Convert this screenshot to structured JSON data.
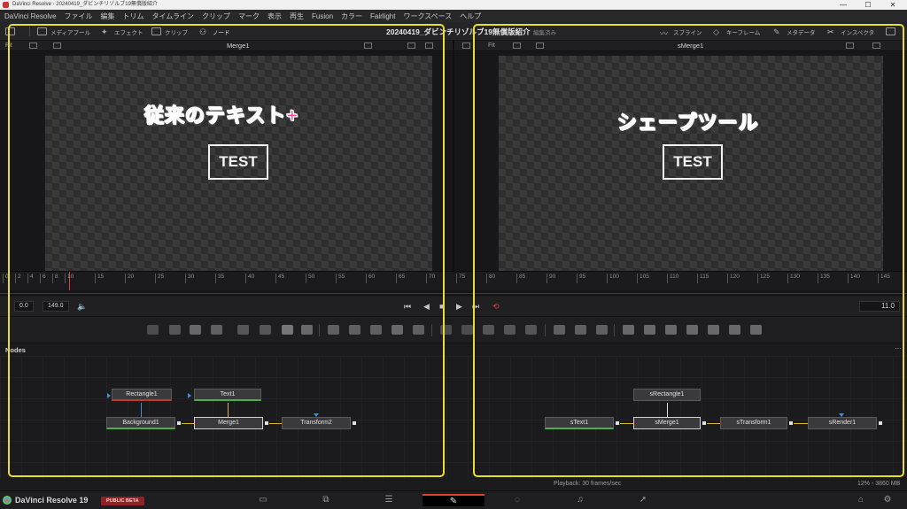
{
  "window": {
    "title": "DaVinci Resolve - 20240419_ダビンチリゾルブ19無償版紹介",
    "minimize": "—",
    "maximize": "☐",
    "close": "✕"
  },
  "menu": [
    "DaVinci Resolve",
    "ファイル",
    "編集",
    "トリム",
    "タイムライン",
    "クリップ",
    "マーク",
    "表示",
    "再生",
    "Fusion",
    "カラー",
    "Fairlight",
    "ワークスペース",
    "ヘルプ"
  ],
  "toolbar": {
    "media_pool": "メディアプール",
    "effects": "エフェクト",
    "clips": "クリップ",
    "nodes": "ノード",
    "project_title": "20240419_ダビンチリゾルブ19無償版紹介",
    "status": "編集済み",
    "spline": "スプライン",
    "keyframes": "キーフレーム",
    "metadata": "メタデータ",
    "inspector": "インスペクタ"
  },
  "viewer_left": {
    "fit": "Fit",
    "title": "Merge1",
    "overlay_text": "TEST",
    "annotation": "従来のテキスト+"
  },
  "viewer_right": {
    "fit": "Fit",
    "title": "sMerge1",
    "overlay_text": "TEST",
    "annotation": "シェープツール"
  },
  "ruler_ticks": [
    "0",
    "2",
    "4",
    "6",
    "8",
    "10",
    "15",
    "20",
    "25",
    "30",
    "35",
    "40",
    "45",
    "50",
    "55",
    "60",
    "65",
    "70",
    "75",
    "80",
    "85",
    "90",
    "95",
    "100",
    "105",
    "110",
    "115",
    "120",
    "125",
    "130",
    "135",
    "140",
    "145"
  ],
  "transport": {
    "start": "0.0",
    "end": "149.0",
    "current": "11.0",
    "volume_icon": "speaker-icon"
  },
  "nodes_panel": {
    "title": "Nodes",
    "more": "···",
    "left": {
      "rectangle": "Rectangle1",
      "text": "Text1",
      "background": "Background1",
      "merge": "Merge1",
      "transform": "Transform2"
    },
    "right": {
      "rectangle": "sRectangle1",
      "text": "sText1",
      "merge": "sMerge1",
      "transform": "sTransform1",
      "render": "sRender1"
    }
  },
  "status": {
    "playback": "Playback: 30 frames/sec",
    "memory": "12% - 3860 MB"
  },
  "pagebar": {
    "brand": "DaVinci Resolve 19",
    "beta": "PUBLIC BETA"
  },
  "colors": {
    "annotation_pink": "#ff3d8f",
    "highlight_yellow": "#e6de33",
    "playhead_red": "#e0403a",
    "node_green": "#4cae4c",
    "node_red": "#c0392b"
  }
}
